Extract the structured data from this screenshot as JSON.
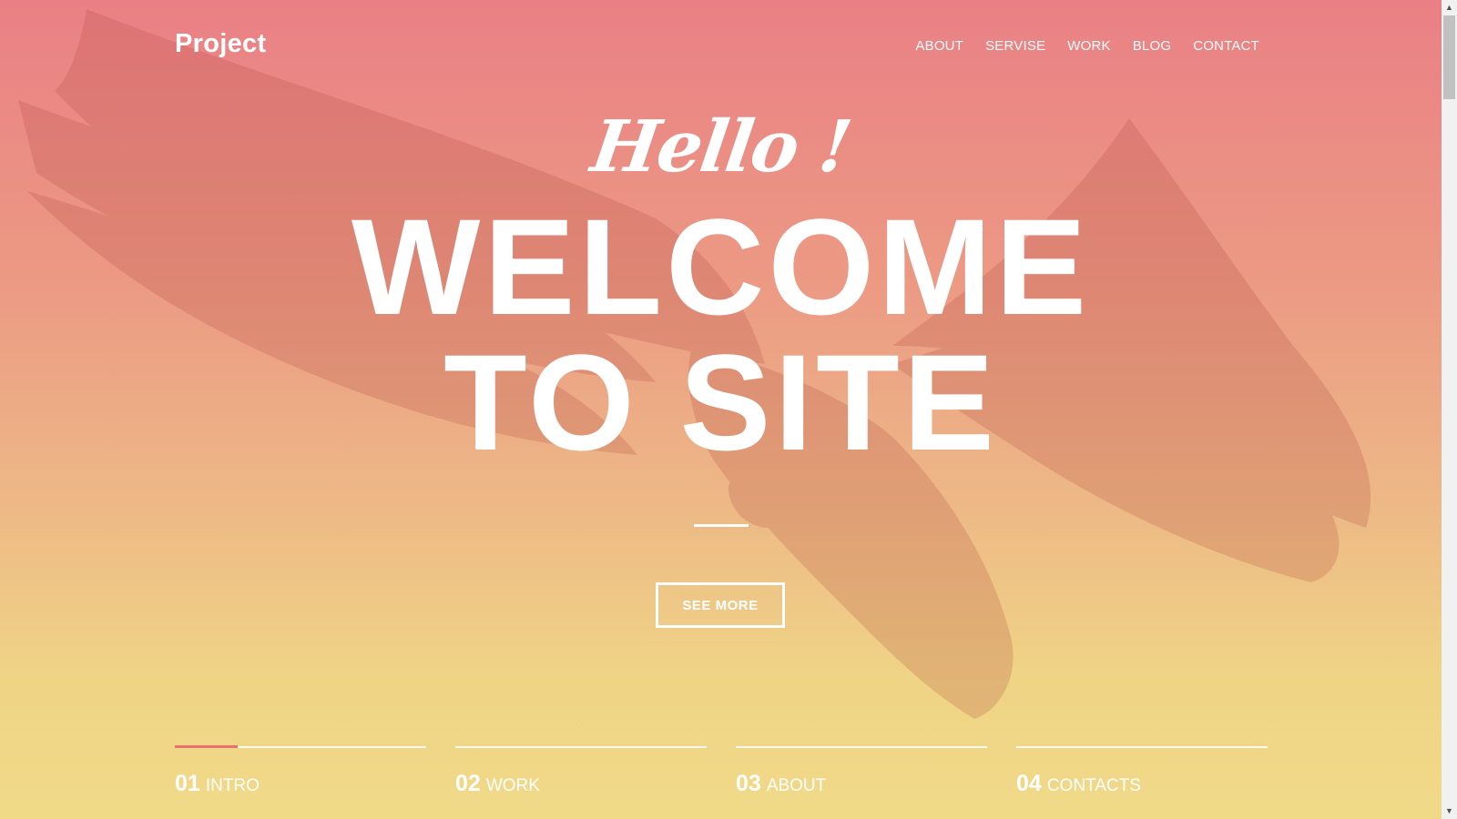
{
  "header": {
    "logo": "Project",
    "nav": [
      "ABOUT",
      "SERVISE",
      "WORK",
      "BLOG",
      "CONTACT"
    ]
  },
  "hero": {
    "greeting": "Hello !",
    "headline_line1": "WELCOME",
    "headline_line2": "TO SITE",
    "cta_label": "SEE MORE",
    "background_image": "eagle-in-flight"
  },
  "steps": [
    {
      "number": "01",
      "label": "INTRO",
      "progress": 0.25
    },
    {
      "number": "02",
      "label": "WORK",
      "progress": 0
    },
    {
      "number": "03",
      "label": "ABOUT",
      "progress": 0
    },
    {
      "number": "04",
      "label": "CONTACTS",
      "progress": 0
    }
  ],
  "colors": {
    "gradient_top": "#ea8085",
    "gradient_bottom": "#f0da88",
    "accent": "#ea6f6f",
    "text": "#ffffff"
  }
}
